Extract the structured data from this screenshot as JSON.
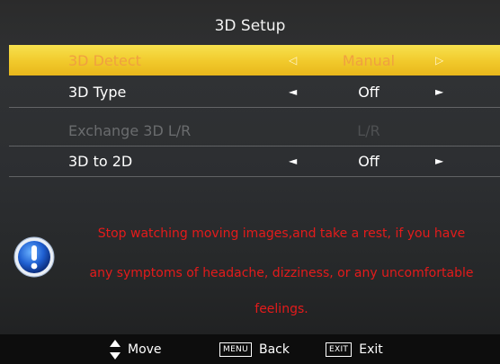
{
  "menu": {
    "title": "3D Setup",
    "items": [
      {
        "label": "3D Detect",
        "value": "Manual",
        "state": "selected",
        "left_arrow": "◁",
        "right_arrow": "▷"
      },
      {
        "label": "3D Type",
        "value": "Off",
        "state": "normal",
        "left_arrow": "◄",
        "right_arrow": "►"
      },
      {
        "label": "Exchange 3D L/R",
        "value": "L/R",
        "state": "disabled"
      },
      {
        "label": "3D to 2D",
        "value": "Off",
        "state": "normal",
        "left_arrow": "◄",
        "right_arrow": "►"
      }
    ]
  },
  "warning": {
    "icon": "info-exclamation-icon",
    "lines": [
      "Stop watching moving images,and take a rest, if you have",
      "any symptoms of headache, dizziness, or any uncomfortable",
      "feelings."
    ],
    "color": "#e41b1b"
  },
  "footer": {
    "move": {
      "icon": "up-down-arrows-icon",
      "label": "Move"
    },
    "back": {
      "key": "MENU",
      "label": "Back"
    },
    "exit": {
      "key": "EXIT",
      "label": "Exit"
    }
  },
  "colors": {
    "highlight": "#f1c92b",
    "highlight_text": "#f0a040",
    "background": "#2c2e31"
  }
}
